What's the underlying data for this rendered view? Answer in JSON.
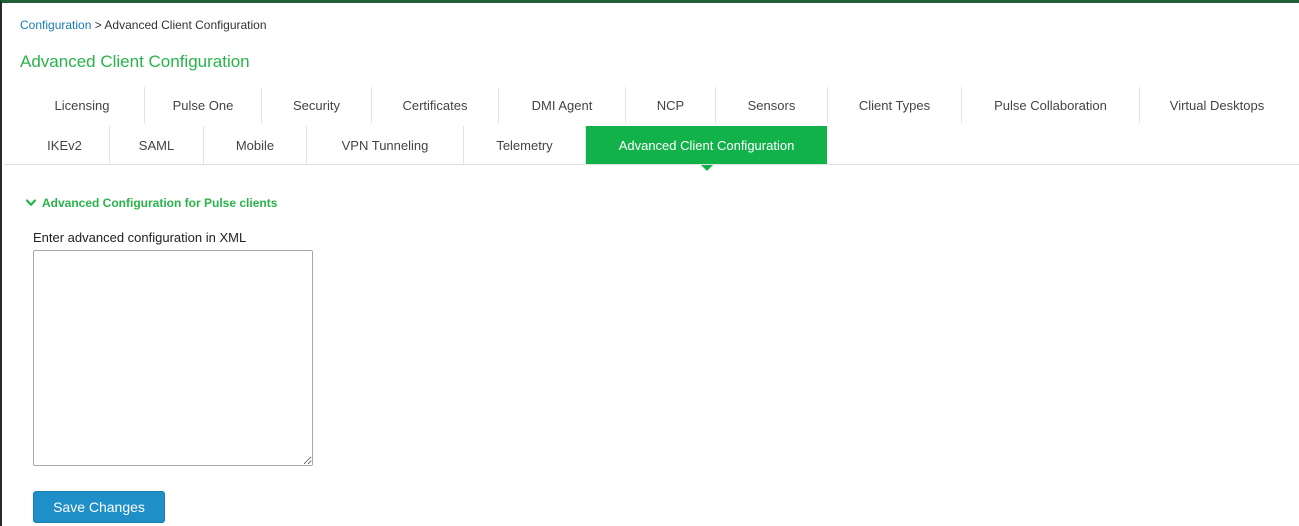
{
  "breadcrumb": {
    "parent": "Configuration",
    "separator": ">",
    "current": "Advanced Client Configuration"
  },
  "page_title": "Advanced Client Configuration",
  "tabs_row1": [
    {
      "label": "Licensing",
      "active": false
    },
    {
      "label": "Pulse One",
      "active": false
    },
    {
      "label": "Security",
      "active": false
    },
    {
      "label": "Certificates",
      "active": false
    },
    {
      "label": "DMI Agent",
      "active": false
    },
    {
      "label": "NCP",
      "active": false
    },
    {
      "label": "Sensors",
      "active": false
    },
    {
      "label": "Client Types",
      "active": false
    },
    {
      "label": "Pulse Collaboration",
      "active": false
    },
    {
      "label": "Virtual Desktops",
      "active": false
    }
  ],
  "tabs_row2": [
    {
      "label": "IKEv2",
      "active": false
    },
    {
      "label": "SAML",
      "active": false
    },
    {
      "label": "Mobile",
      "active": false
    },
    {
      "label": "VPN Tunneling",
      "active": false
    },
    {
      "label": "Telemetry",
      "active": false
    },
    {
      "label": "Advanced Client Configuration",
      "active": true
    }
  ],
  "section": {
    "title": "Advanced Configuration for Pulse clients",
    "expanded": true,
    "icon": "chevron-down-icon"
  },
  "xml_field": {
    "label": "Enter advanced configuration in XML",
    "value": "",
    "placeholder": ""
  },
  "save_button": {
    "label": "Save Changes"
  },
  "colors": {
    "accent_green": "#12b24b",
    "title_green": "#28b44a",
    "link_blue": "#1a7ab5",
    "button_blue": "#1f8fc8"
  }
}
